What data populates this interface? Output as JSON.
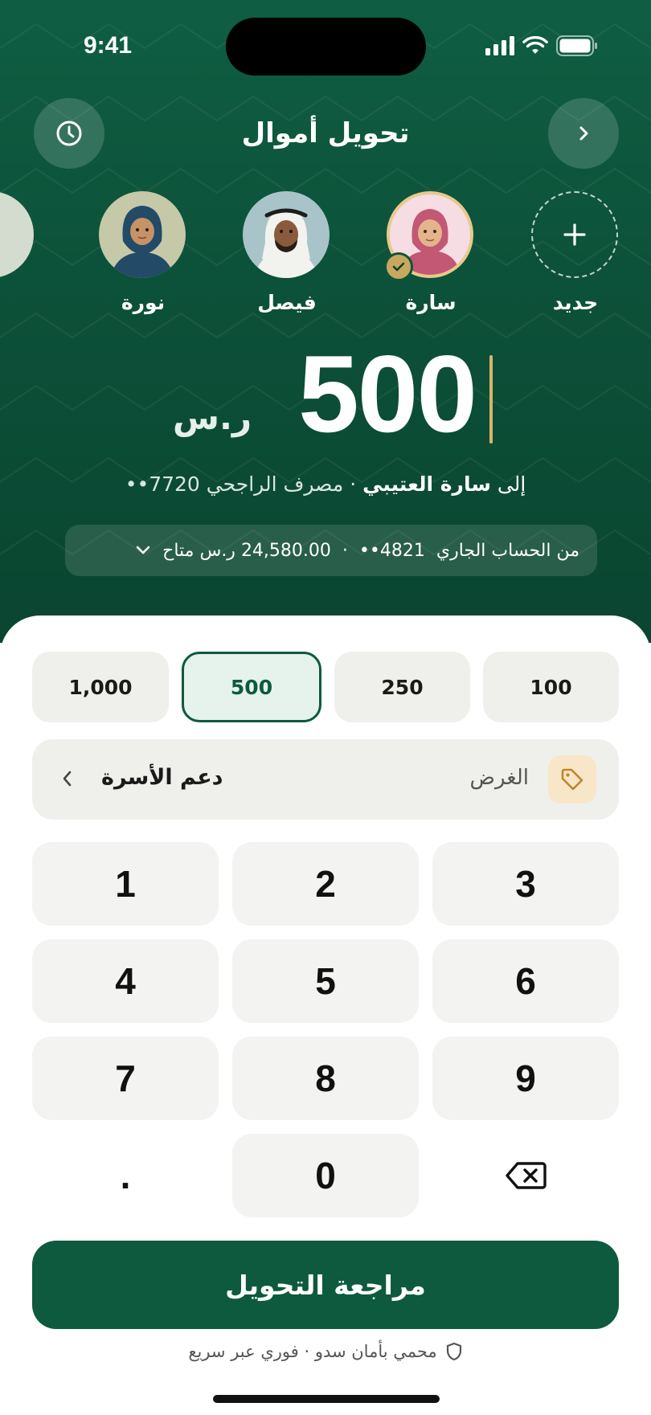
{
  "status_bar": {
    "time": "9:41"
  },
  "header": {
    "title": "تحويل أموال"
  },
  "recipients": [
    {
      "name": "جديد",
      "kind": "new"
    },
    {
      "name": "سارة",
      "kind": "contact",
      "selected": true
    },
    {
      "name": "فيصل",
      "kind": "contact"
    },
    {
      "name": "نورة",
      "kind": "contact"
    }
  ],
  "amount": {
    "value": "500",
    "currency": "ر.س"
  },
  "destination": {
    "prefix": "إلى",
    "name": "سارة العتيبي",
    "separator": "·",
    "bank": "مصرف الراجحي",
    "account": "••7720"
  },
  "source": {
    "label": "من الحساب الجاري",
    "account": "••4821",
    "separator": "·",
    "balance": "24,580.00 ر.س متاح"
  },
  "quick_amounts": [
    {
      "label": "100",
      "active": false
    },
    {
      "label": "250",
      "active": false
    },
    {
      "label": "500",
      "active": true
    },
    {
      "label": "1,000",
      "active": false
    }
  ],
  "purpose": {
    "label": "الغرض",
    "value": "دعم الأسرة"
  },
  "keypad": [
    "1",
    "2",
    "3",
    "4",
    "5",
    "6",
    "7",
    "8",
    "9",
    ".",
    "0"
  ],
  "cta": {
    "label": "مراجعة التحويل"
  },
  "footer": {
    "security_text": "محمي بأمان سدو · فوري عبر سريع"
  },
  "colors": {
    "brand_green": "#0d5a3f",
    "accent_gold": "#c9a85d",
    "key_bg": "#f3f3f1"
  },
  "icons": [
    "history-icon",
    "back-chevron-icon",
    "plus-icon",
    "check-icon",
    "tag-icon",
    "chevron-left-icon",
    "backspace-icon",
    "shield-icon"
  ]
}
